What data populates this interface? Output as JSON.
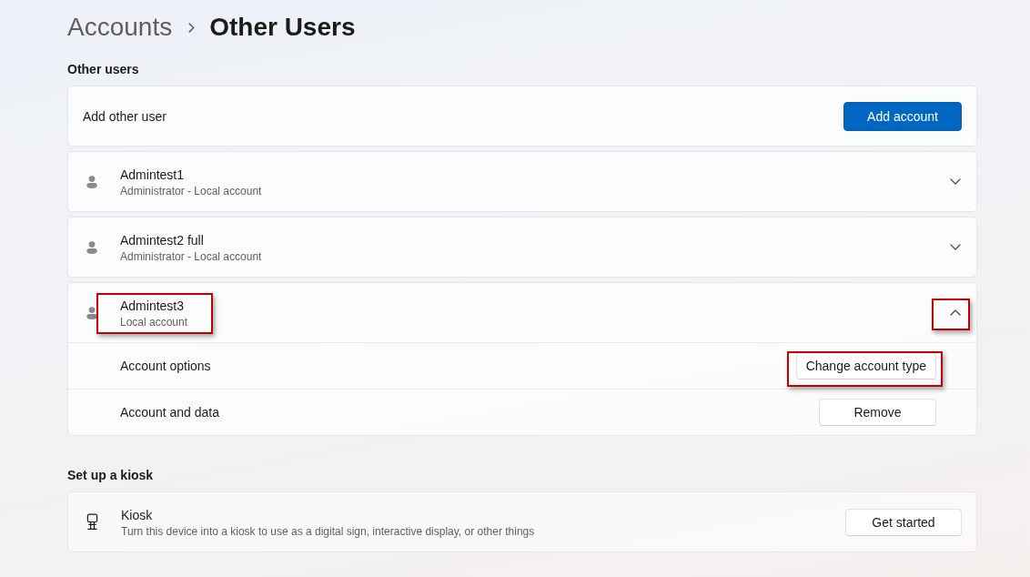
{
  "breadcrumb": {
    "parent": "Accounts",
    "current": "Other Users"
  },
  "other_users": {
    "heading": "Other users",
    "add_user": {
      "label": "Add other user",
      "button": "Add account"
    },
    "users": [
      {
        "name": "Admintest1",
        "subtitle": "Administrator - Local account",
        "expanded": false,
        "name_highlighted": false,
        "toggle_highlighted": false
      },
      {
        "name": "Admintest2 full",
        "subtitle": "Administrator - Local account",
        "expanded": false,
        "name_highlighted": false,
        "toggle_highlighted": false
      },
      {
        "name": "Admintest3",
        "subtitle": "Local account",
        "expanded": true,
        "name_highlighted": true,
        "toggle_highlighted": true,
        "options": [
          {
            "label": "Account options",
            "button": "Change account type",
            "button_highlighted": true
          },
          {
            "label": "Account and data",
            "button": "Remove",
            "button_highlighted": false
          }
        ]
      }
    ]
  },
  "kiosk": {
    "heading": "Set up a kiosk",
    "title": "Kiosk",
    "description": "Turn this device into a kiosk to use as a digital sign, interactive display, or other things",
    "button": "Get started"
  }
}
